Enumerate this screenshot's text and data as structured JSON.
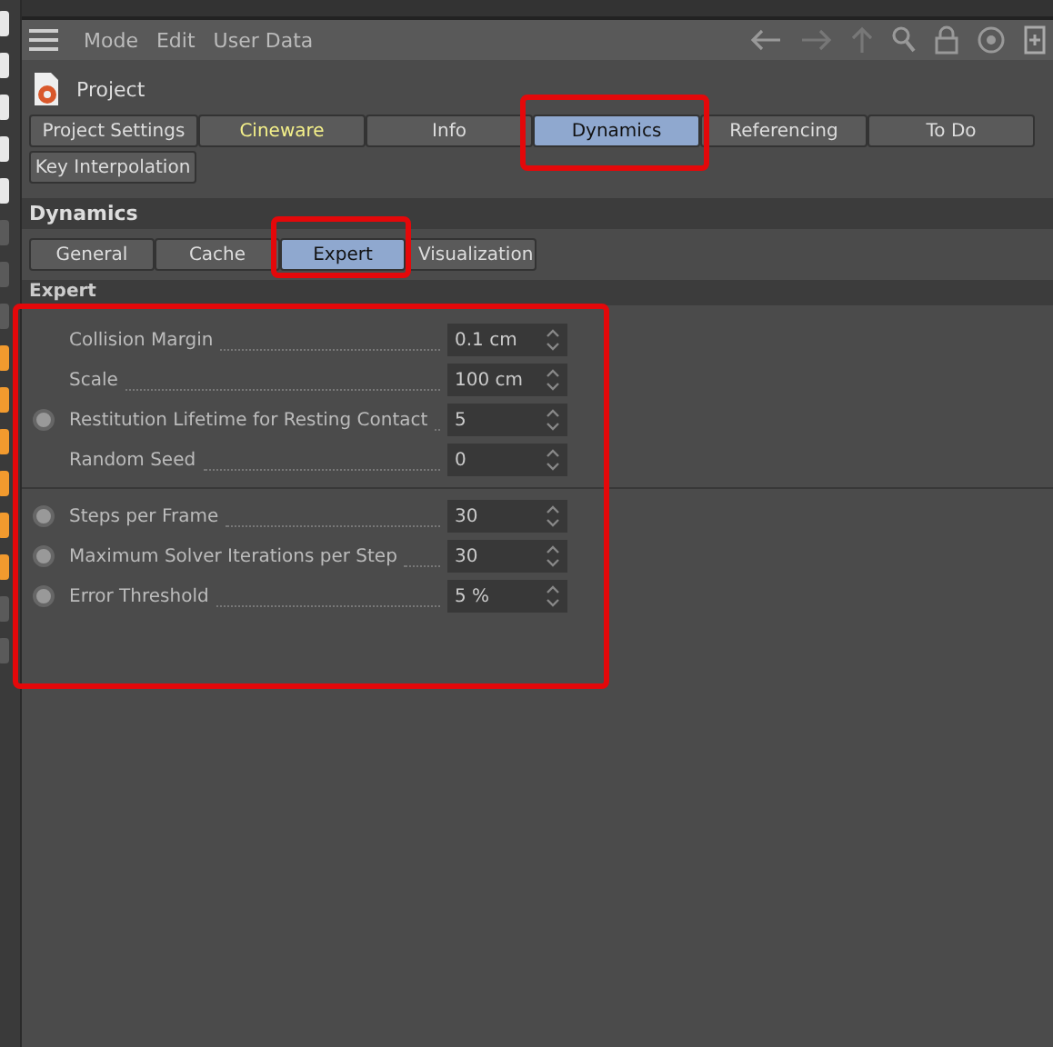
{
  "menu": [
    "Mode",
    "Edit",
    "User Data"
  ],
  "object": {
    "name": "Project"
  },
  "tabs": [
    {
      "label": "Project Settings",
      "selected": false,
      "accent": false
    },
    {
      "label": "Cineware",
      "selected": false,
      "accent": true
    },
    {
      "label": "Info",
      "selected": false,
      "accent": false
    },
    {
      "label": "Dynamics",
      "selected": true,
      "accent": false
    },
    {
      "label": "Referencing",
      "selected": false,
      "accent": false
    },
    {
      "label": "To Do",
      "selected": false,
      "accent": false
    },
    {
      "label": "Key Interpolation",
      "selected": false,
      "accent": false
    }
  ],
  "section": "Dynamics",
  "subtabs": [
    {
      "label": "General",
      "selected": false
    },
    {
      "label": "Cache",
      "selected": false
    },
    {
      "label": "Expert",
      "selected": true
    },
    {
      "label": "Visualization",
      "selected": false
    }
  ],
  "group": {
    "title": "Expert",
    "params": [
      [
        {
          "label": "Collision Margin",
          "value": "0.1 cm",
          "keyframe": false
        },
        {
          "label": "Scale",
          "value": "100 cm",
          "keyframe": false
        },
        {
          "label": "Restitution Lifetime for Resting Contact",
          "value": "5",
          "keyframe": true
        },
        {
          "label": "Random Seed",
          "value": "0",
          "keyframe": false
        }
      ],
      [
        {
          "label": "Steps per Frame",
          "value": "30",
          "keyframe": true
        },
        {
          "label": "Maximum Solver Iterations per Step",
          "value": "30",
          "keyframe": true
        },
        {
          "label": "Error Threshold",
          "value": "5 %",
          "keyframe": true
        }
      ]
    ]
  }
}
